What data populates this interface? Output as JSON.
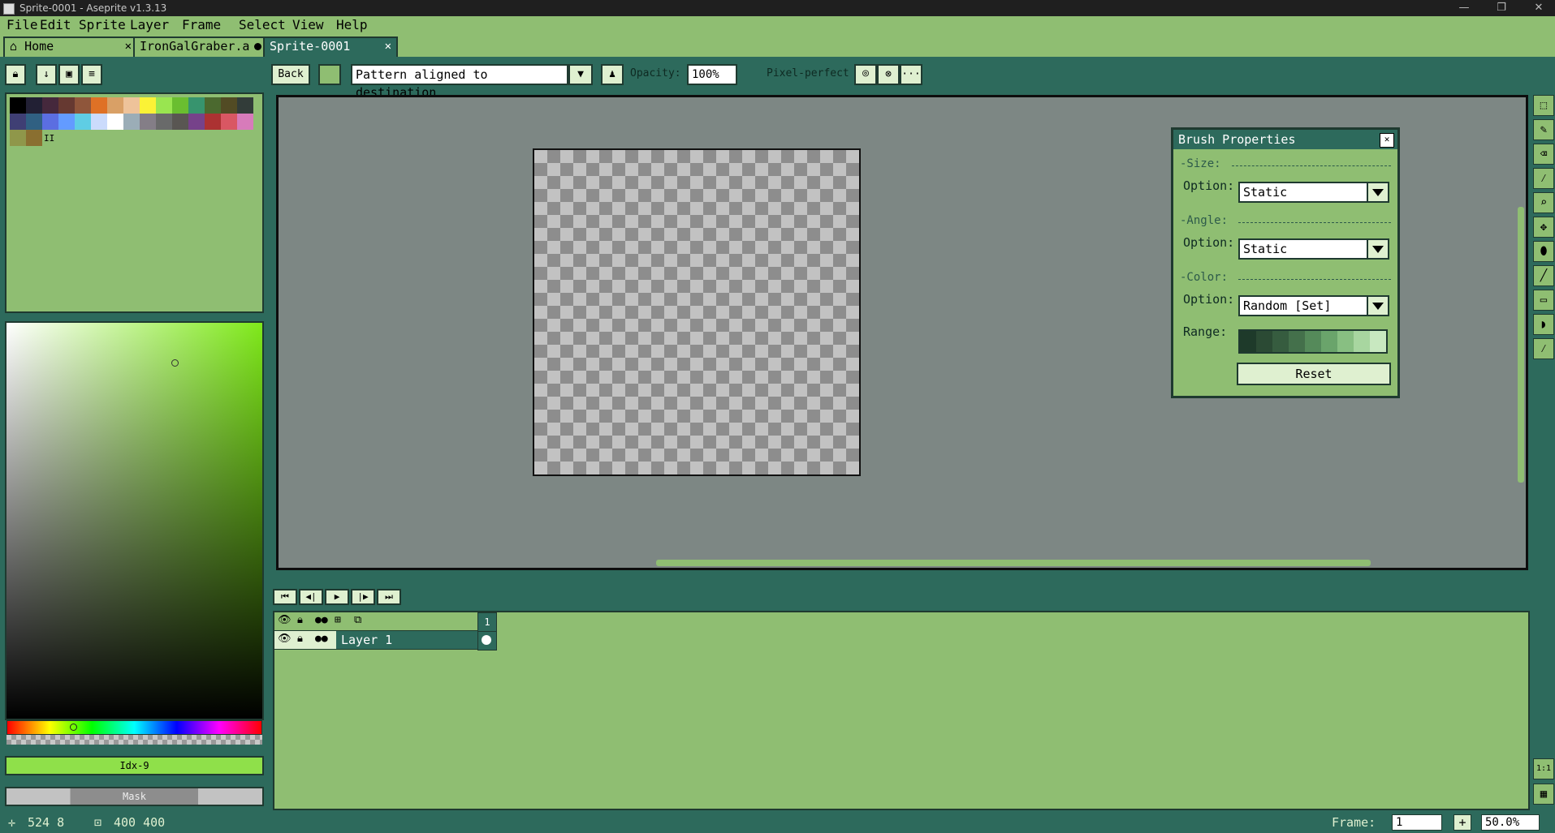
{
  "window": {
    "title": "Sprite-0001 - Aseprite v1.3.13",
    "minimize": "—",
    "maximize": "❐",
    "close": "✕"
  },
  "menu": {
    "items": [
      "File",
      "Edit",
      "Sprite",
      "Layer",
      "Frame",
      "Select",
      "View",
      "Help"
    ]
  },
  "tabs": [
    {
      "label": "Home",
      "close": "✕"
    },
    {
      "label": "IronGalGraber.a"
    },
    {
      "label": "Sprite-0001",
      "close": "✕"
    }
  ],
  "toolbar": {
    "back_label": "Back",
    "ink_mode": "Pattern aligned to destination",
    "opacity_label": "Opacity:",
    "opacity_value": "100%",
    "pixel_perfect_label": "Pixel-perfect",
    "more_label": "···"
  },
  "palette": {
    "colors": [
      "#000000",
      "#222034",
      "#45283c",
      "#663931",
      "#8f563b",
      "#df7126",
      "#d9a066",
      "#eec39a",
      "#fbf236",
      "#99e550",
      "#6abe30",
      "#37946e",
      "#4b692f",
      "#524b24",
      "#323c39",
      "#3f3f74",
      "#306082",
      "#5b6ee1",
      "#639bff",
      "#5fcde4",
      "#cbdbfc",
      "#ffffff",
      "#9badb7",
      "#847e87",
      "#696a6a",
      "#595652",
      "#76428a",
      "#ac3232",
      "#d95763",
      "#d77bba",
      "#8f974a",
      "#8a6f30"
    ],
    "more_indicator": "II",
    "accent": "#8fbe72",
    "dark": "#2d6a5c"
  },
  "color_picker": {
    "index_label": "Idx-9",
    "mask_label": "Mask"
  },
  "brush_properties": {
    "title": "Brush Properties",
    "size_section": "-Size:",
    "angle_section": "-Angle:",
    "color_section": "-Color:",
    "option_label": "Option:",
    "size_option": "Static",
    "angle_option": "Static",
    "color_option": "Random [Set]",
    "range_label": "Range:",
    "range_colors": [
      "#1e3a2a",
      "#2b4a34",
      "#365c3f",
      "#44704b",
      "#558a5a",
      "#6aa46b",
      "#88bf82",
      "#a8d6a0",
      "#c8e8c0"
    ],
    "reset_label": "Reset"
  },
  "timeline": {
    "frame_header": "1",
    "layers": [
      {
        "name": "Layer 1"
      }
    ]
  },
  "status": {
    "cursor_pos": "524 8",
    "sprite_size": "400 400",
    "frame_label": "Frame:",
    "frame_value": "1",
    "add_frame": "+",
    "zoom_value": "50.0%"
  }
}
